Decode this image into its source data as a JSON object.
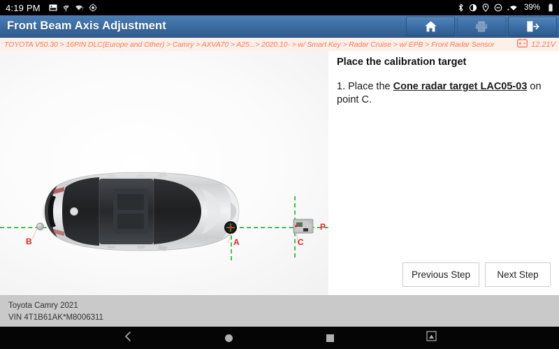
{
  "statusbar": {
    "time": "4:19 PM",
    "left_icons": [
      "screenshot-icon",
      "usb-icon",
      "wifi-question-icon",
      "brightness-icon"
    ],
    "right_icons": [
      "bluetooth-icon",
      "brightness-half-icon",
      "location-icon",
      "do-not-disturb-icon",
      "wifi-icon"
    ],
    "battery_percent": "39%"
  },
  "titlebar": {
    "title": "Front Beam Axis Adjustment",
    "buttons": [
      {
        "name": "home-button",
        "icon": "home-icon",
        "enabled": true
      },
      {
        "name": "print-button",
        "icon": "printer-icon",
        "enabled": false
      },
      {
        "name": "exit-button",
        "icon": "exit-icon",
        "enabled": true
      }
    ],
    "accent_color": "#3d6ea4"
  },
  "breadcrumb": {
    "path": "TOYOTA V50.30 > 16PIN DLC(Europe and Other) > Camry > AXVA70 > A25...> 2020.10- > w/ Smart Key > Radar Cruise > w/ EPB > Front Radar Sensor",
    "battery_icon": "car-battery-icon",
    "voltage": "12.21V",
    "text_color": "#f9775a",
    "background_color": "#fdf0e9"
  },
  "instructions": {
    "heading": "Place the calibration target",
    "step_number": "1. Place the ",
    "step_emphasis": "Cone radar target LAC05-03",
    "step_tail": " on point C."
  },
  "step_buttons": {
    "previous": "Previous Step",
    "next": "Next Step"
  },
  "diagram": {
    "vehicle": "toyota-camry-top-view",
    "axis_color": "#3ec04a",
    "label_color": "#e8231f",
    "points": [
      {
        "id": "B",
        "label": "B",
        "desc": "rear-center-reference-point"
      },
      {
        "id": "A",
        "label": "A",
        "desc": "front-center-target-point"
      },
      {
        "id": "C",
        "label": "C",
        "desc": "cone-radar-target-position"
      },
      {
        "id": "P",
        "label": "P",
        "desc": "centerline-projection-point"
      }
    ]
  },
  "footer": {
    "vehicle": "Toyota Camry 2021",
    "vin": "VIN 4T1B61AK*M8006311"
  },
  "navbar": {
    "buttons": [
      "back-icon",
      "home-icon",
      "recents-icon",
      "screenshot-icon"
    ]
  }
}
